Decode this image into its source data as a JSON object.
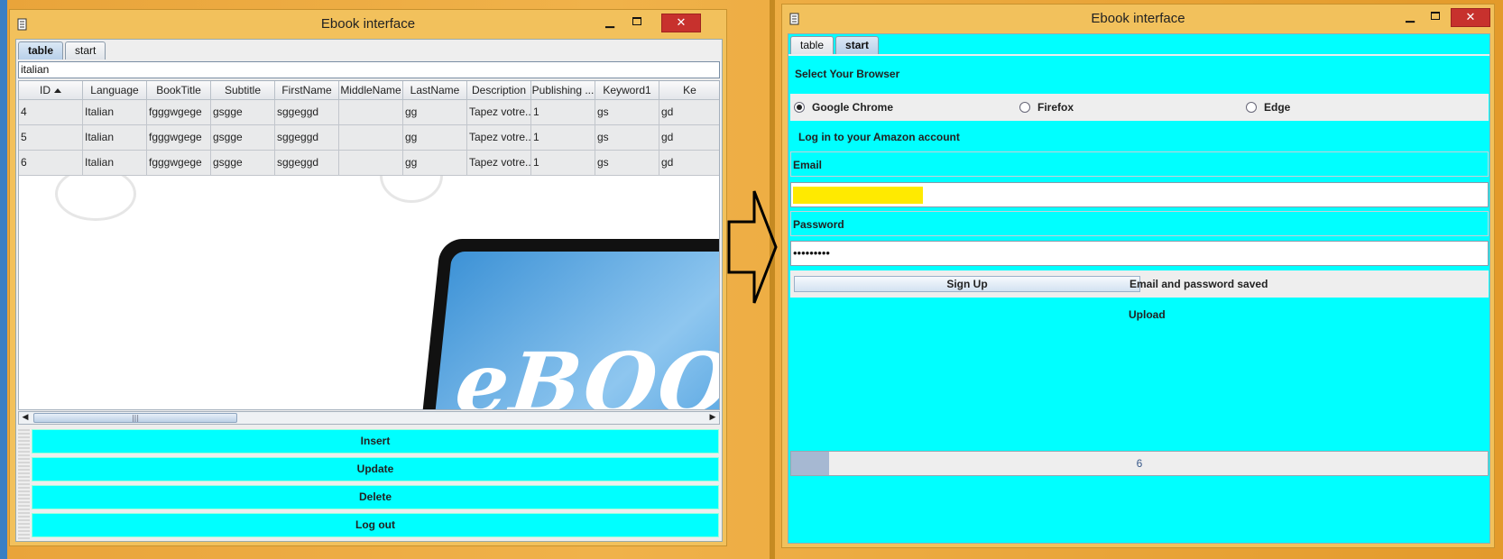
{
  "left_window": {
    "title": "Ebook interface",
    "tabs": [
      {
        "label": "table",
        "active": true
      },
      {
        "label": "start",
        "active": false
      }
    ],
    "search_value": "italian",
    "table": {
      "columns": [
        "ID",
        "Language",
        "BookTitle",
        "Subtitle",
        "FirstName",
        "MiddleName",
        "LastName",
        "Description",
        "Publishing ...",
        "Keyword1",
        "Ke"
      ],
      "rows": [
        [
          "4",
          "Italian",
          "fgggwgege",
          "gsgge",
          "sggeggd",
          "",
          "gg",
          "Tapez votre...",
          "1",
          "gs",
          "gd"
        ],
        [
          "5",
          "Italian",
          "fgggwgege",
          "gsgge",
          "sggeggd",
          "",
          "gg",
          "Tapez votre...",
          "1",
          "gs",
          "gd"
        ],
        [
          "6",
          "Italian",
          "fgggwgege",
          "gsgge",
          "sggeggd",
          "",
          "gg",
          "Tapez votre...",
          "1",
          "gs",
          "gd"
        ]
      ]
    },
    "actions": {
      "insert": "Insert",
      "update": "Update",
      "delete": "Delete",
      "logout": "Log out"
    }
  },
  "right_window": {
    "title": "Ebook interface",
    "tabs": [
      {
        "label": "table",
        "active": false
      },
      {
        "label": "start",
        "active": true
      }
    ],
    "browser_heading": "Select Your Browser",
    "browsers": [
      {
        "label": "Google Chrome",
        "selected": true
      },
      {
        "label": "Firefox",
        "selected": false
      },
      {
        "label": "Edge",
        "selected": false
      }
    ],
    "login_heading": "Log in to your Amazon account",
    "email_label": "Email",
    "email_value": "",
    "password_label": "Password",
    "password_value": "•••••••••",
    "signup_label": "Sign Up",
    "saved_status": "Email and password saved",
    "upload_label": "Upload",
    "progress": {
      "text": "6",
      "fraction": 0.055
    }
  },
  "colors": {
    "accent_cyan": "#00ffff",
    "window_frame": "#f2c15c",
    "close_red": "#c7312d",
    "highlight_yellow": "#ffea00"
  },
  "icons": [
    "app-icon",
    "minimize-icon",
    "maximize-icon",
    "close-icon",
    "sort-ascending-icon",
    "scroll-left-icon",
    "scroll-right-icon",
    "arrow-right-icon"
  ]
}
